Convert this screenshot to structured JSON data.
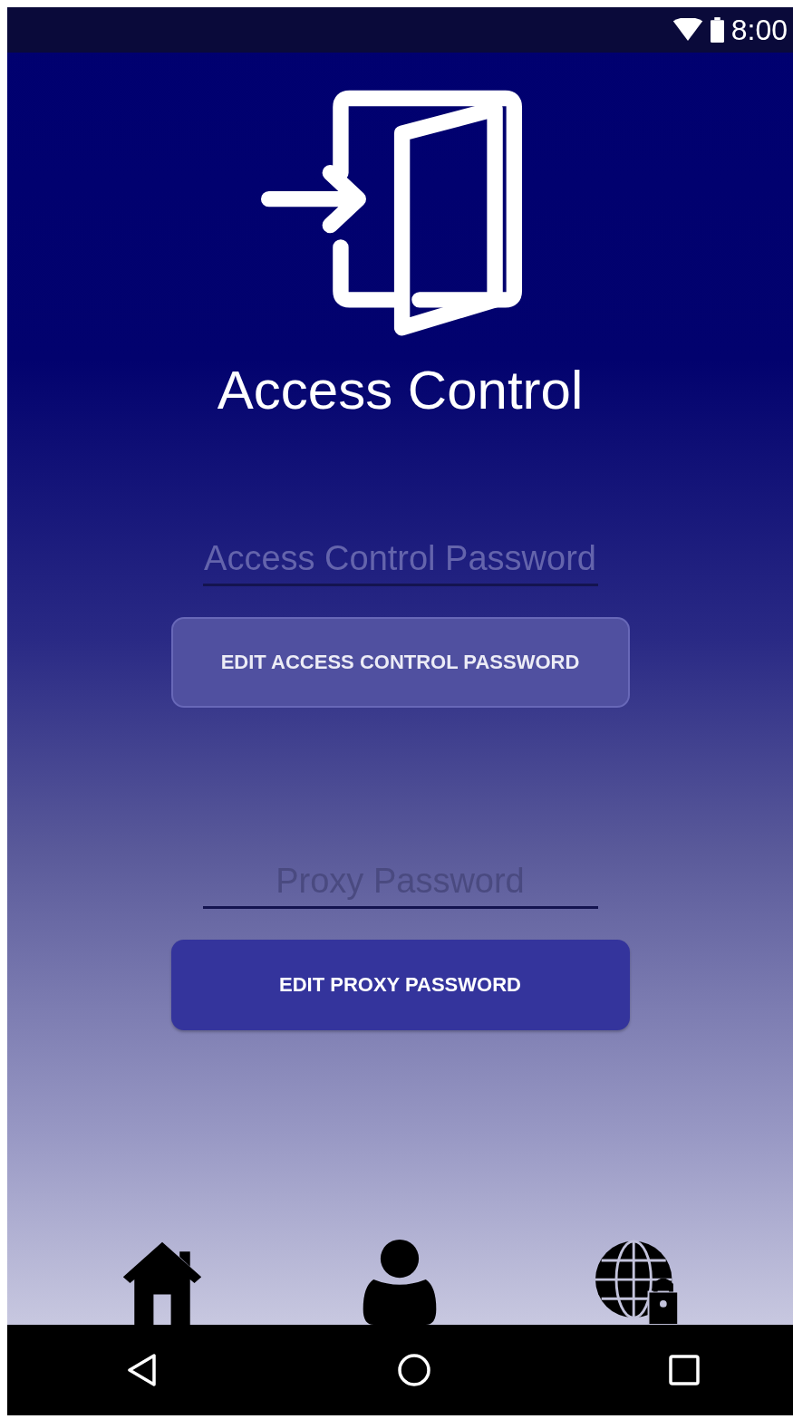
{
  "status_bar": {
    "time": "8:00"
  },
  "app": {
    "title": "Access Control"
  },
  "sections": [
    {
      "field": {
        "placeholder": "Access Control Password"
      },
      "button": {
        "label": "EDIT ACCESS CONTROL PASSWORD",
        "disabled": true
      }
    },
    {
      "field": {
        "placeholder": "Proxy Password"
      },
      "button": {
        "label": "EDIT PROXY PASSWORD",
        "disabled": false
      }
    }
  ],
  "bottom_nav": [
    {
      "kind": "home"
    },
    {
      "kind": "user"
    },
    {
      "kind": "globe-lock"
    }
  ],
  "system_nav": [
    {
      "kind": "back"
    },
    {
      "kind": "home"
    },
    {
      "kind": "recents"
    }
  ]
}
